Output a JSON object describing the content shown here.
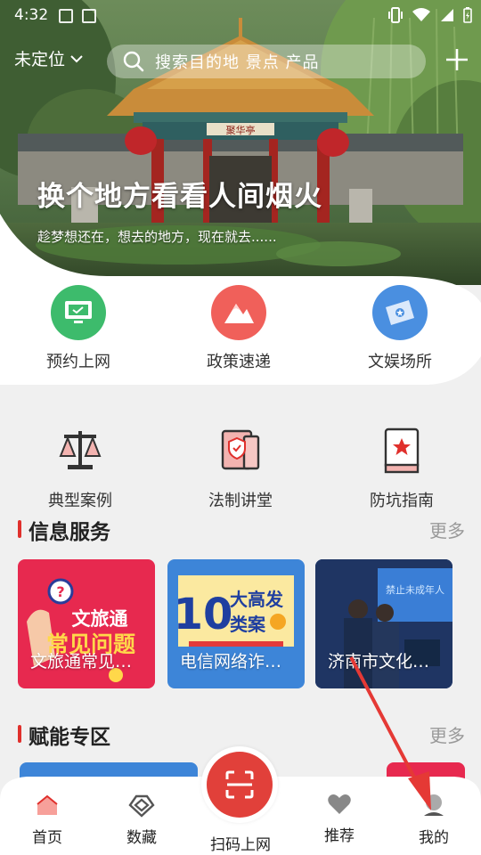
{
  "status_bar": {
    "time": "4:32"
  },
  "header": {
    "location_label": "未定位",
    "search_placeholder": "搜索目的地 景点 产品"
  },
  "hero": {
    "title": "换个地方看看人间烟火",
    "subtitle": "趁梦想还在，想去的地方，现在就去......",
    "pavilion_sign": "聚华亭"
  },
  "quick_row_1": [
    {
      "label": "预约上网",
      "icon": "monitor-icon",
      "color": "#3dbb6c"
    },
    {
      "label": "政策速递",
      "icon": "mountain-icon",
      "color": "#f0605a"
    },
    {
      "label": "文娱场所",
      "icon": "ticket-icon",
      "color": "#4a8fe0"
    }
  ],
  "quick_row_2": [
    {
      "label": "典型案例",
      "icon": "scales-icon"
    },
    {
      "label": "法制讲堂",
      "icon": "shield-book-icon"
    },
    {
      "label": "防坑指南",
      "icon": "star-book-icon"
    }
  ],
  "info_section": {
    "title": "信息服务",
    "more": "更多",
    "cards": [
      {
        "caption": "文旅通常见…",
        "art_line1": "文旅通",
        "art_line2": "常见问题",
        "color": "#e7294f"
      },
      {
        "caption": "电信网络诈…",
        "art_big": "10",
        "art_line1": "大高发",
        "art_line2": "类案",
        "color": "#3d85d8"
      },
      {
        "caption": "济南市文化…",
        "art_sign": "禁止未成年人",
        "color": "#2a4f9a"
      }
    ]
  },
  "empower_section": {
    "title": "赋能专区",
    "more": "更多"
  },
  "bottom_nav": {
    "home": "首页",
    "collection": "数藏",
    "scan": "扫码上网",
    "recommend": "推荐",
    "mine": "我的"
  },
  "colors": {
    "accent": "#e0302c",
    "annotation_arrow": "#e53935"
  }
}
